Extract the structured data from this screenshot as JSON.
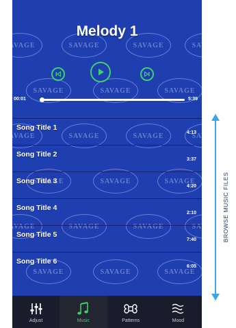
{
  "player": {
    "title": "Melody 1",
    "current_time": "00:01",
    "total_time": "5:39",
    "progress_fraction": 0.01,
    "watermark_text": "SAVAGE"
  },
  "playlist": [
    {
      "title": "Song Title 1",
      "duration": "4:13"
    },
    {
      "title": "Song Title 2",
      "duration": "3:37"
    },
    {
      "title": "Song Title 3",
      "duration": "4:20"
    },
    {
      "title": "Song Title 4",
      "duration": "2:10"
    },
    {
      "title": "Song Title 5",
      "duration": "7:40"
    },
    {
      "title": "Song Title 6",
      "duration": "6:05"
    }
  ],
  "tabs": [
    {
      "label": "Adjust",
      "icon": "sliders-icon",
      "active": false
    },
    {
      "label": "Music",
      "icon": "music-note-icon",
      "active": true
    },
    {
      "label": "Patterns",
      "icon": "command-icon",
      "active": false
    },
    {
      "label": "Mood",
      "icon": "wind-icon",
      "active": false
    }
  ],
  "annotation": {
    "label": "BROWSE  MUSIC FILES"
  },
  "colors": {
    "background": "#1f3fb0",
    "accent": "#3fd06b",
    "tabbar": "#1a1c2c",
    "annotation": "#1c3a66"
  }
}
